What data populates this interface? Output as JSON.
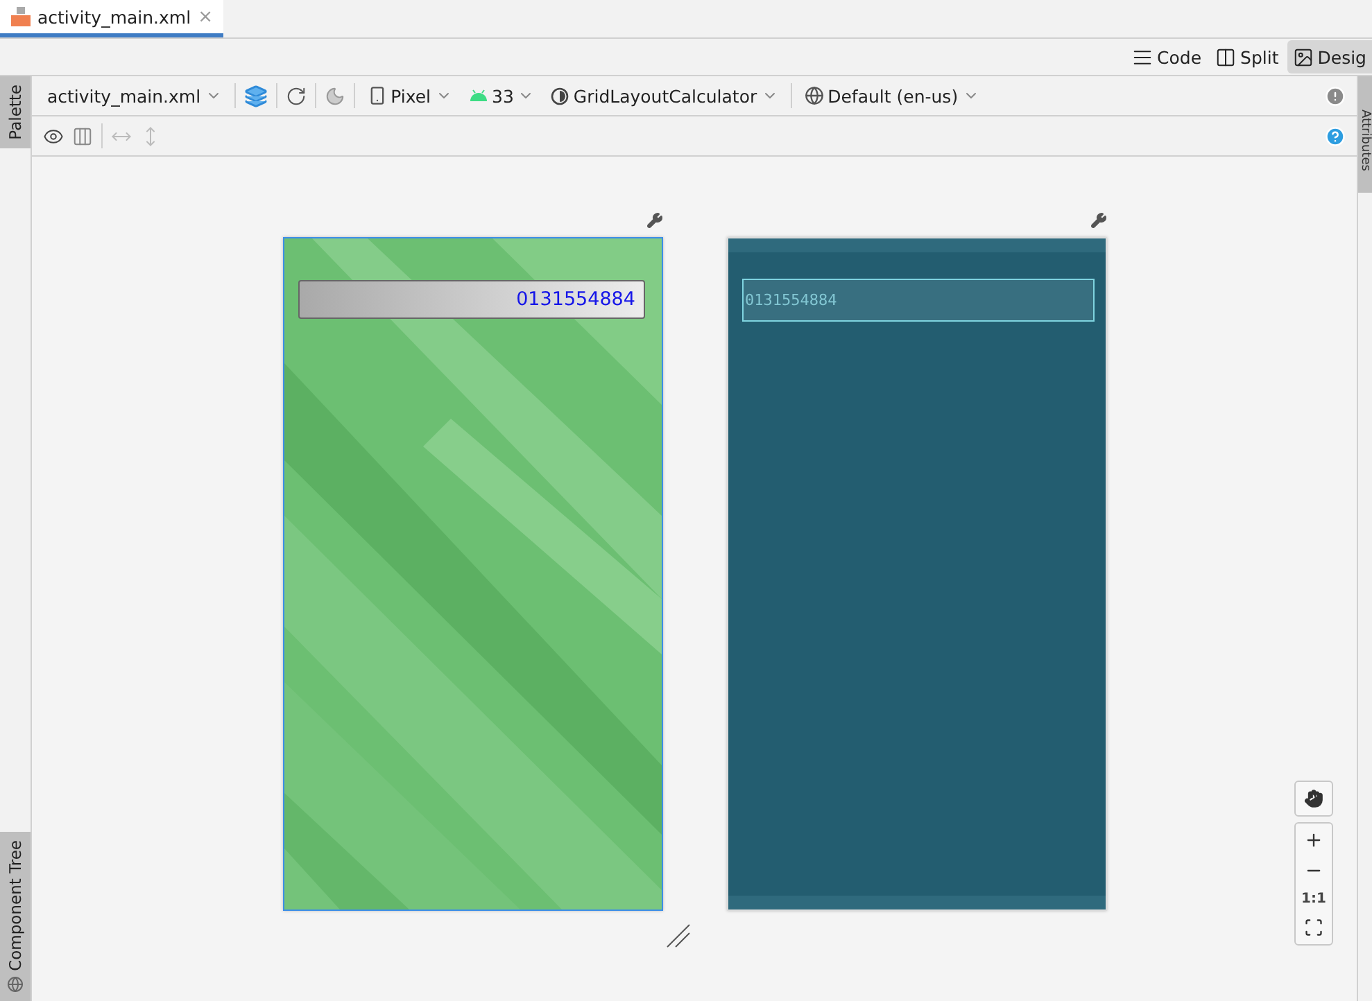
{
  "editor_tabs": [
    {
      "label": "activity_main.xml",
      "selected": true,
      "close": "×"
    }
  ],
  "view_modes": [
    {
      "kind": "code",
      "label": "Code",
      "selected": false
    },
    {
      "kind": "split",
      "label": "Split",
      "selected": false
    },
    {
      "kind": "design",
      "label": "Desig",
      "selected": true
    }
  ],
  "side_tabs": {
    "left_top": "Palette",
    "left_bottom": "Component Tree",
    "right": "Attributes"
  },
  "toolbar": {
    "file": "activity_main.xml",
    "device": "Pixel",
    "api": "33",
    "theme": "GridLayoutCalculator",
    "locale": "Default (en-us)"
  },
  "previews": [
    {
      "kind": "design",
      "display": "0131554884",
      "selected": true
    },
    {
      "kind": "blueprint",
      "display": "0131554884",
      "selected": false
    }
  ],
  "zoom_controls": {
    "actual_size": "1:1"
  }
}
